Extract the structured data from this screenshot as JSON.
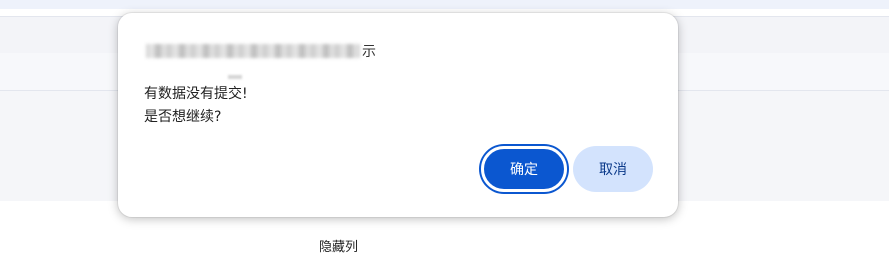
{
  "background": {
    "footer_label": "隐藏列"
  },
  "dialog": {
    "title_suffix": "示",
    "message_line1": "有数据没有提交!",
    "message_line2": "是否想继续?",
    "ok_label": "确定",
    "cancel_label": "取消"
  },
  "colors": {
    "primary": "#0b57d0",
    "secondary_bg": "#d3e3fd"
  }
}
